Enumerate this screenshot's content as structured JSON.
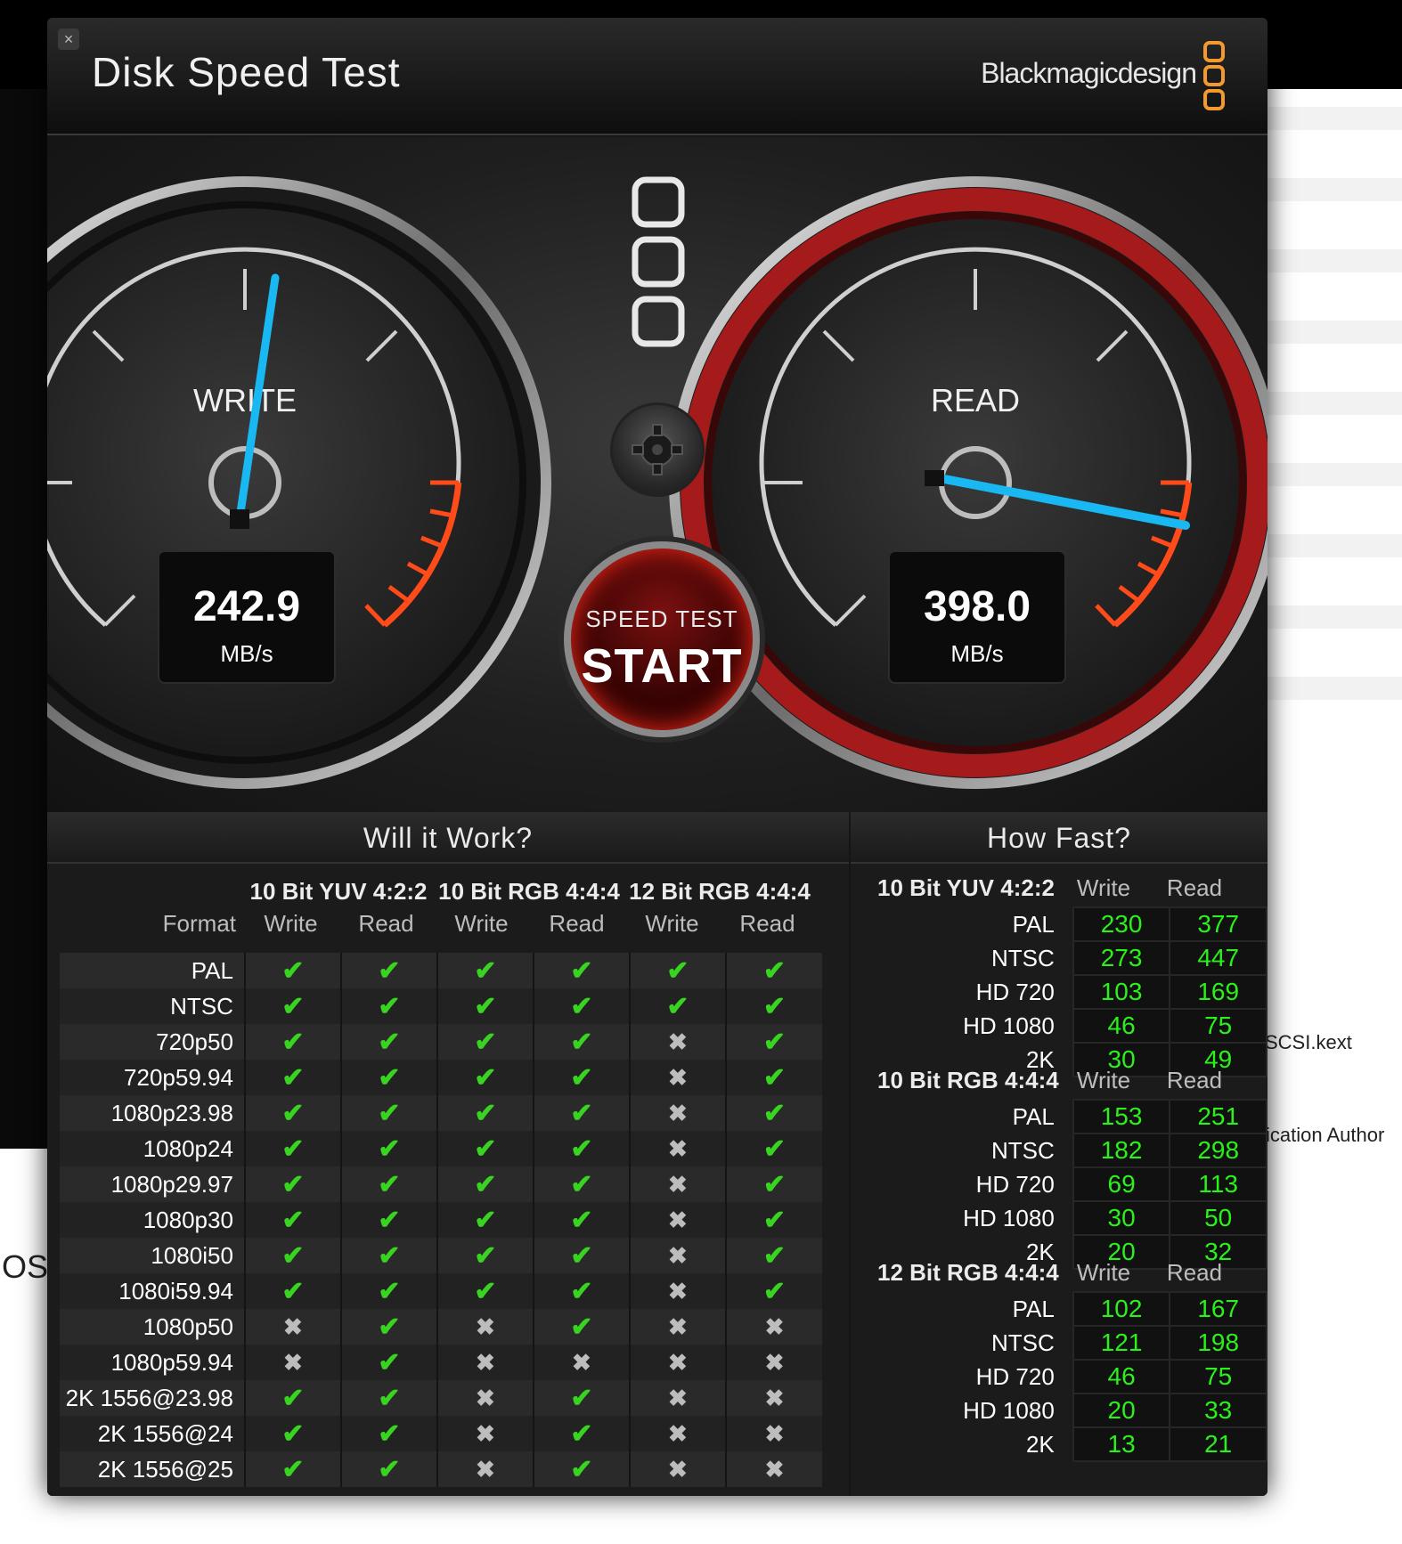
{
  "background": {
    "text_1": "SCSI.kext",
    "text_2": "ification Author",
    "text_3": "OS"
  },
  "window": {
    "close_icon": "×",
    "title": "Disk Speed Test",
    "brand": "Blackmagicdesign",
    "accent_color": "#f29a2e"
  },
  "gauges": {
    "write": {
      "label": "WRITE",
      "value": "242.9",
      "unit": "MB/s",
      "needle_color": "#1ab8f2"
    },
    "read": {
      "label": "READ",
      "value": "398.0",
      "unit": "MB/s",
      "needle_color": "#1ab8f2"
    }
  },
  "start_button": {
    "sub": "SPEED TEST",
    "main": "START"
  },
  "settings_icon": "gear-icon",
  "will_it_work": {
    "title": "Will it Work?",
    "format_label": "Format",
    "groups": [
      "10 Bit YUV 4:2:2",
      "10 Bit RGB 4:4:4",
      "12 Bit RGB 4:4:4"
    ],
    "sub_labels": [
      "Write",
      "Read",
      "Write",
      "Read",
      "Write",
      "Read"
    ],
    "rows": [
      {
        "format": "PAL",
        "cells": [
          1,
          1,
          1,
          1,
          1,
          1
        ]
      },
      {
        "format": "NTSC",
        "cells": [
          1,
          1,
          1,
          1,
          1,
          1
        ]
      },
      {
        "format": "720p50",
        "cells": [
          1,
          1,
          1,
          1,
          0,
          1
        ]
      },
      {
        "format": "720p59.94",
        "cells": [
          1,
          1,
          1,
          1,
          0,
          1
        ]
      },
      {
        "format": "1080p23.98",
        "cells": [
          1,
          1,
          1,
          1,
          0,
          1
        ]
      },
      {
        "format": "1080p24",
        "cells": [
          1,
          1,
          1,
          1,
          0,
          1
        ]
      },
      {
        "format": "1080p29.97",
        "cells": [
          1,
          1,
          1,
          1,
          0,
          1
        ]
      },
      {
        "format": "1080p30",
        "cells": [
          1,
          1,
          1,
          1,
          0,
          1
        ]
      },
      {
        "format": "1080i50",
        "cells": [
          1,
          1,
          1,
          1,
          0,
          1
        ]
      },
      {
        "format": "1080i59.94",
        "cells": [
          1,
          1,
          1,
          1,
          0,
          1
        ]
      },
      {
        "format": "1080p50",
        "cells": [
          0,
          1,
          0,
          1,
          0,
          0
        ]
      },
      {
        "format": "1080p59.94",
        "cells": [
          0,
          1,
          0,
          0,
          0,
          0
        ]
      },
      {
        "format": "2K 1556@23.98",
        "cells": [
          1,
          1,
          0,
          1,
          0,
          0
        ]
      },
      {
        "format": "2K 1556@24",
        "cells": [
          1,
          1,
          0,
          1,
          0,
          0
        ]
      },
      {
        "format": "2K 1556@25",
        "cells": [
          1,
          1,
          0,
          1,
          0,
          0
        ]
      }
    ]
  },
  "how_fast": {
    "title": "How Fast?",
    "write_label": "Write",
    "read_label": "Read",
    "sections": [
      {
        "group": "10 Bit YUV 4:2:2",
        "rows": [
          {
            "format": "PAL",
            "write": "230",
            "read": "377"
          },
          {
            "format": "NTSC",
            "write": "273",
            "read": "447"
          },
          {
            "format": "HD 720",
            "write": "103",
            "read": "169"
          },
          {
            "format": "HD 1080",
            "write": "46",
            "read": "75"
          },
          {
            "format": "2K",
            "write": "30",
            "read": "49"
          }
        ]
      },
      {
        "group": "10 Bit RGB 4:4:4",
        "rows": [
          {
            "format": "PAL",
            "write": "153",
            "read": "251"
          },
          {
            "format": "NTSC",
            "write": "182",
            "read": "298"
          },
          {
            "format": "HD 720",
            "write": "69",
            "read": "113"
          },
          {
            "format": "HD 1080",
            "write": "30",
            "read": "50"
          },
          {
            "format": "2K",
            "write": "20",
            "read": "32"
          }
        ]
      },
      {
        "group": "12 Bit RGB 4:4:4",
        "rows": [
          {
            "format": "PAL",
            "write": "102",
            "read": "167"
          },
          {
            "format": "NTSC",
            "write": "121",
            "read": "198"
          },
          {
            "format": "HD 720",
            "write": "46",
            "read": "75"
          },
          {
            "format": "HD 1080",
            "write": "20",
            "read": "33"
          },
          {
            "format": "2K",
            "write": "13",
            "read": "21"
          }
        ]
      }
    ]
  }
}
